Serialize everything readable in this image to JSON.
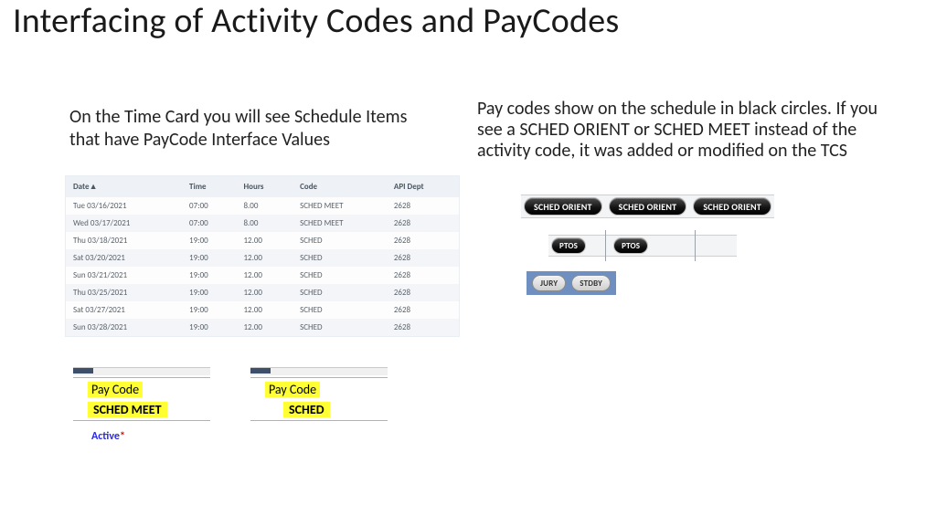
{
  "title": "Interfacing of Activity Codes and PayCodes",
  "left_paragraph": "On the Time Card you will see Schedule Items that have PayCode Interface Values",
  "right_paragraph": "Pay codes show on the schedule in black circles.  If you see a SCHED ORIENT or SCHED MEET instead of the activity code, it was added or modified on the TCS",
  "table": {
    "headers": [
      "Date",
      "Time",
      "Hours",
      "Code",
      "API Dept"
    ],
    "rows": [
      [
        "Tue 03/16/2021",
        "07:00",
        "8.00",
        "SCHED MEET",
        "2628"
      ],
      [
        "Wed 03/17/2021",
        "07:00",
        "8.00",
        "SCHED MEET",
        "2628"
      ],
      [
        "Thu 03/18/2021",
        "19:00",
        "12.00",
        "SCHED",
        "2628"
      ],
      [
        "Sat 03/20/2021",
        "19:00",
        "12.00",
        "SCHED",
        "2628"
      ],
      [
        "Sun 03/21/2021",
        "19:00",
        "12.00",
        "SCHED",
        "2628"
      ],
      [
        "Thu 03/25/2021",
        "19:00",
        "12.00",
        "SCHED",
        "2628"
      ],
      [
        "Sat 03/27/2021",
        "19:00",
        "12.00",
        "SCHED",
        "2628"
      ],
      [
        "Sun 03/28/2021",
        "19:00",
        "12.00",
        "SCHED",
        "2628"
      ]
    ]
  },
  "paycode1": {
    "label": "Pay Code",
    "value": "SCHED MEET",
    "active": "Active",
    "asterisk": "*"
  },
  "paycode2": {
    "label": "Pay Code",
    "value": "SCHED"
  },
  "pills": {
    "row_a": [
      "SCHED ORIENT",
      "SCHED ORIENT",
      "SCHED ORIENT"
    ],
    "row_b": [
      "PTOS",
      "PTOS"
    ],
    "row_c": [
      "JURY",
      "STDBY"
    ]
  }
}
